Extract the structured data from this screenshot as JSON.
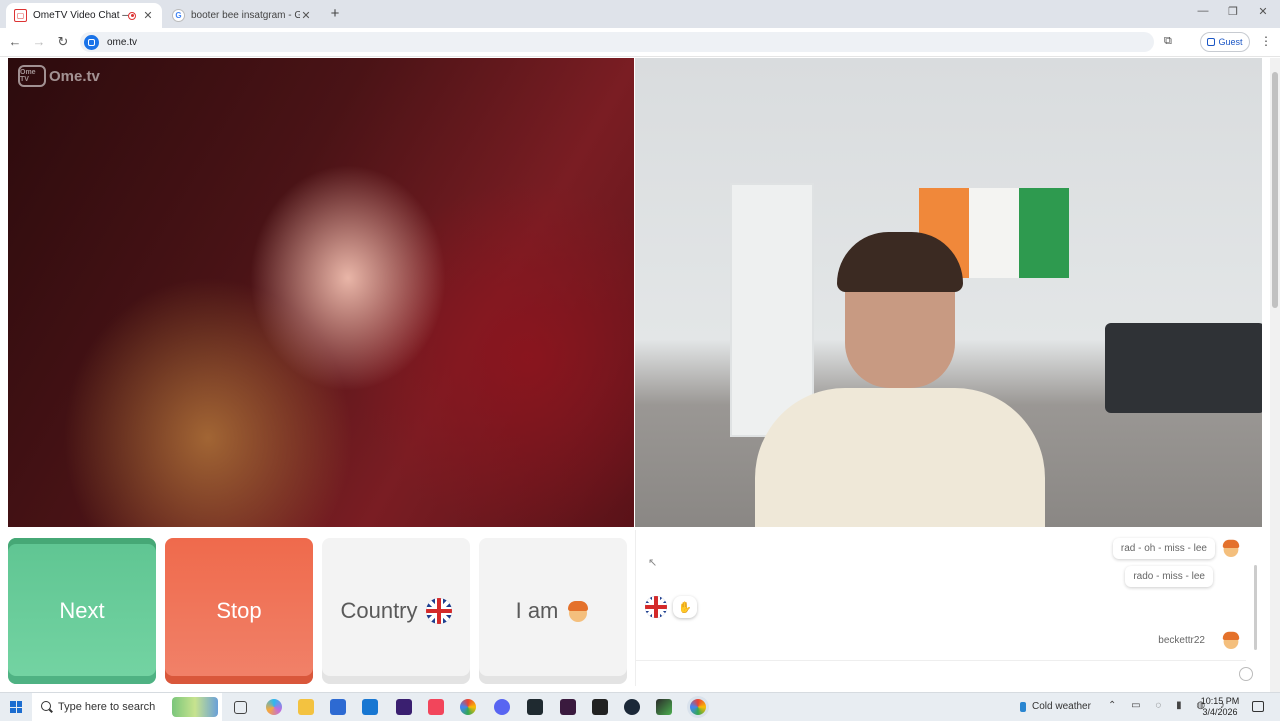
{
  "browser": {
    "tabs": [
      {
        "title": "OmeTV Video Chat — Ome",
        "active": true
      },
      {
        "title": "booter bee insatgram - Google",
        "active": false
      }
    ],
    "url": "ome.tv",
    "profile_label": "Guest"
  },
  "page": {
    "logo_text": "Ome.tv",
    "logo_badge": "Ome TV",
    "controls": {
      "next_label": "Next",
      "stop_label": "Stop",
      "country_label": "Country",
      "iam_label": "I am"
    },
    "chat": {
      "messages": [
        {
          "text": "rad - oh - miss - lee",
          "has_avatar": true
        },
        {
          "text": "rado - miss - lee",
          "has_avatar": false
        },
        {
          "text": "beckettr22",
          "has_avatar": true
        }
      ],
      "partner_country": "uk-flag",
      "partner_gesture": "hand-icon"
    }
  },
  "taskbar": {
    "search_placeholder": "Type here to search",
    "weather": "Cold weather",
    "time": "10:15 PM",
    "date": "3/4/2026"
  },
  "colors": {
    "next": "#5fc592",
    "stop": "#ef6a4c",
    "neutral_button": "#f3f3f3",
    "accent_blue": "#1a73e8"
  }
}
